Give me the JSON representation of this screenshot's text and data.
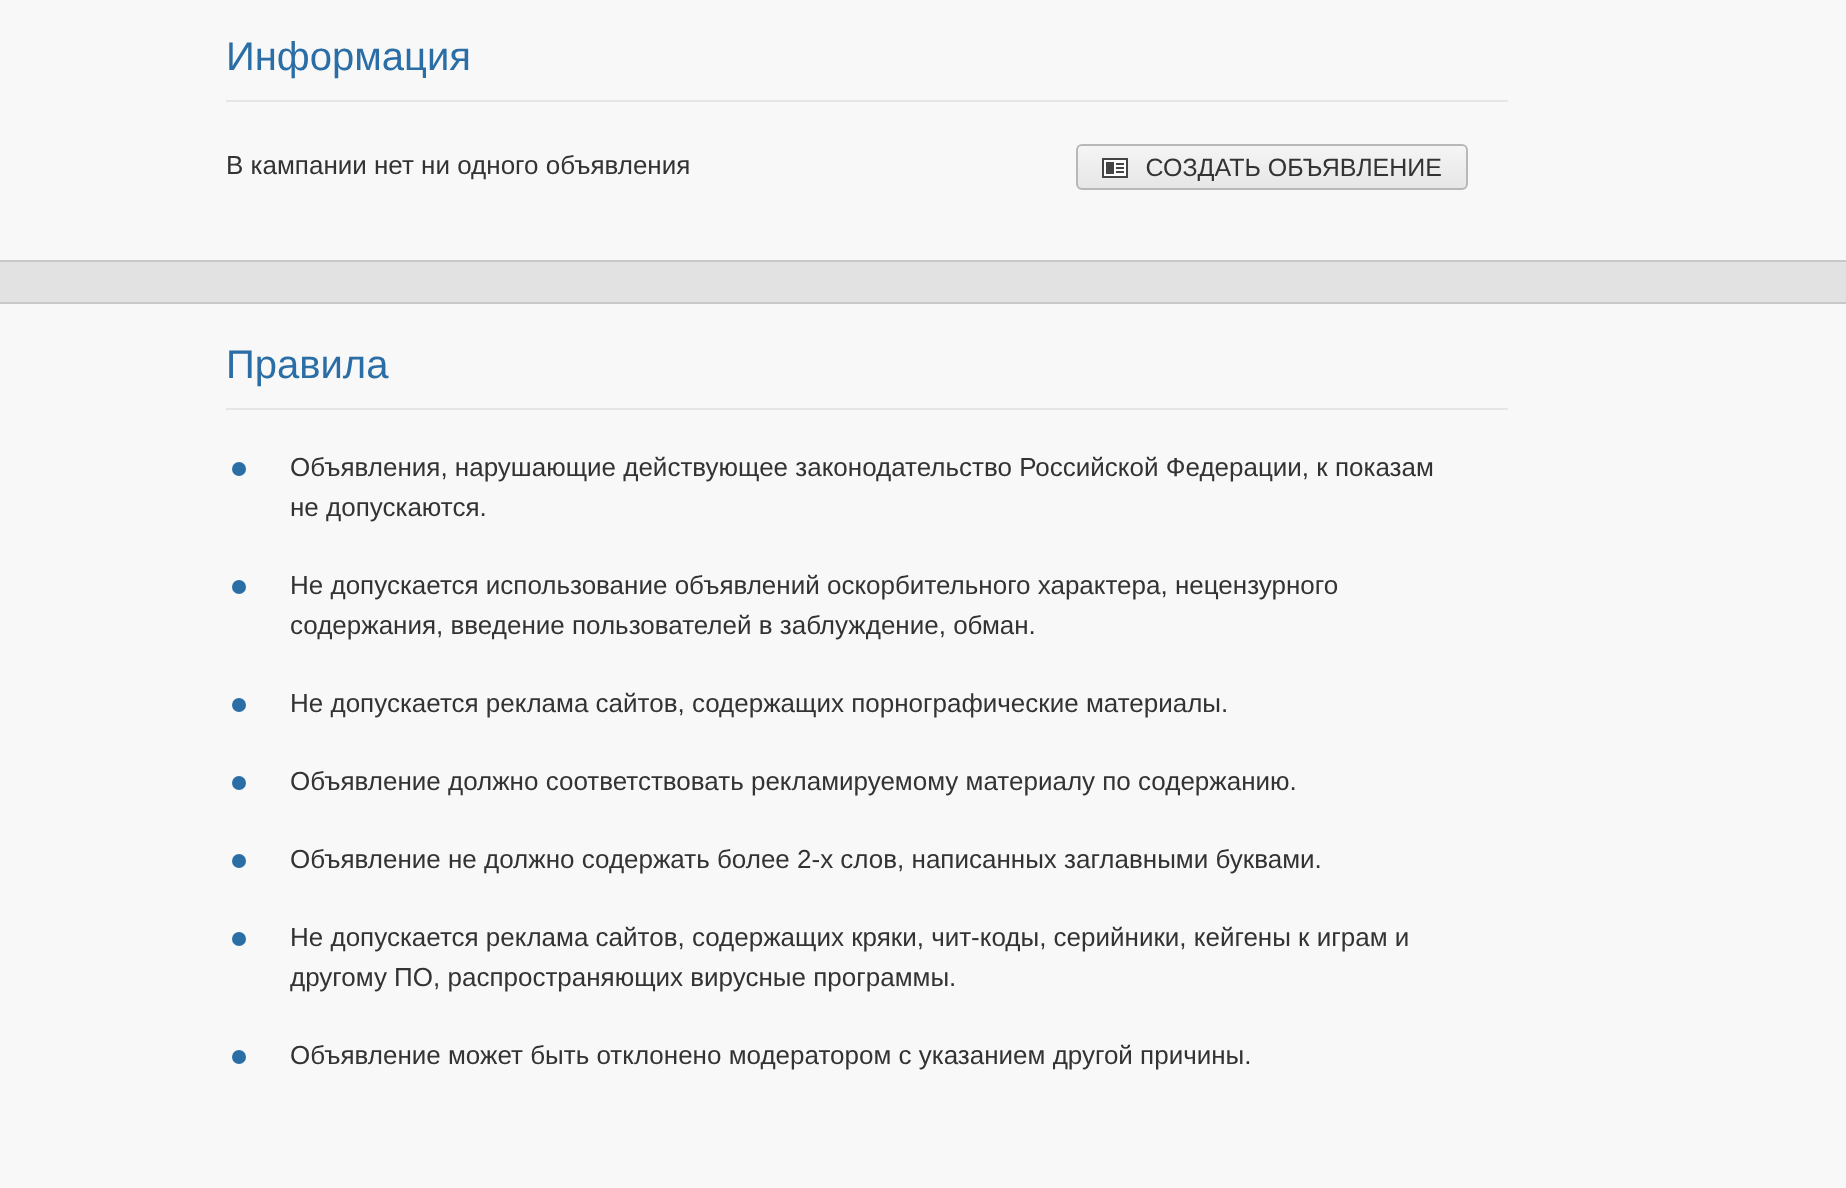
{
  "info": {
    "title": "Информация",
    "message": "В кампании нет ни одного объявления",
    "button": "СОЗДАТЬ ОБЪЯВЛЕНИЕ"
  },
  "rules": {
    "title": "Правила",
    "items": [
      "Объявления, нарушающие действующее законодательство Российской Федерации, к показам не допускаются.",
      "Не допускается использование объявлений оскорбительного характера, нецензурного содержания, введение пользователей в заблуждение, обман.",
      "Не допускается реклама сайтов, содержащих порнографические материалы.",
      "Объявление должно соответствовать рекламируемому материалу по содержанию.",
      "Объявление не должно содержать более 2-х слов, написанных заглавными буквами.",
      "Не допускается реклама сайтов, содержащих кряки, чит-коды, серийники, кейгены к играм и другому ПО, распространяющих вирусные программы.",
      "Объявление может быть отклонено модератором с указанием другой причины."
    ]
  }
}
